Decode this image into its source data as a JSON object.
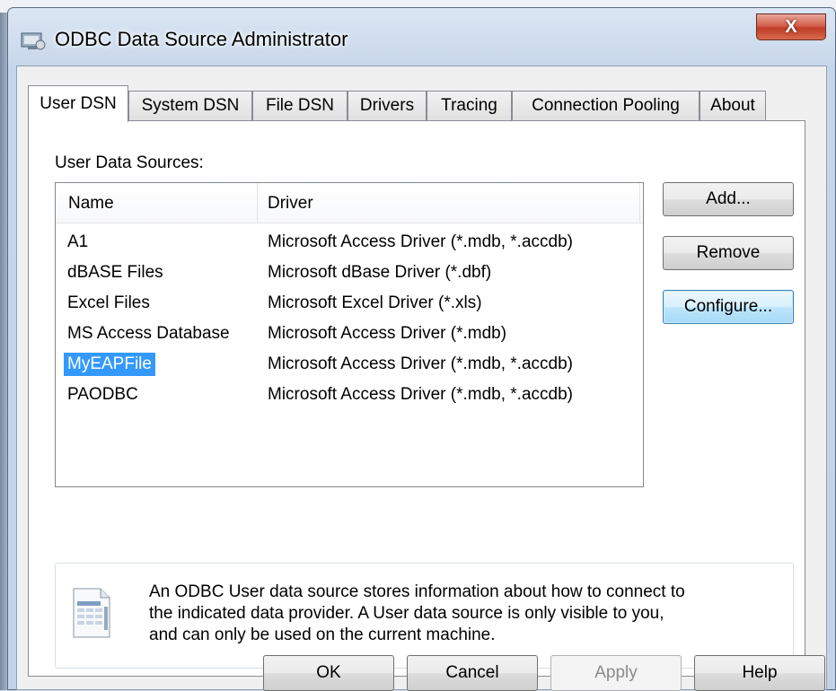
{
  "window": {
    "title": "ODBC Data Source Administrator",
    "close_glyph": "X"
  },
  "tabs": [
    {
      "label": "User DSN",
      "active": true
    },
    {
      "label": "System DSN"
    },
    {
      "label": "File DSN"
    },
    {
      "label": "Drivers"
    },
    {
      "label": "Tracing"
    },
    {
      "label": "Connection Pooling"
    },
    {
      "label": "About"
    }
  ],
  "user_dsn": {
    "section_label": "User Data Sources:",
    "columns": {
      "name": "Name",
      "driver": "Driver"
    },
    "rows": [
      {
        "name": "A1",
        "driver": "Microsoft Access Driver (*.mdb, *.accdb)"
      },
      {
        "name": "dBASE Files",
        "driver": "Microsoft dBase Driver (*.dbf)"
      },
      {
        "name": "Excel Files",
        "driver": "Microsoft Excel Driver (*.xls)"
      },
      {
        "name": "MS Access Database",
        "driver": "Microsoft Access Driver (*.mdb)"
      },
      {
        "name": "MyEAPFile",
        "driver": "Microsoft Access Driver (*.mdb, *.accdb)",
        "selected": true
      },
      {
        "name": "PAODBC",
        "driver": "Microsoft Access Driver (*.mdb, *.accdb)"
      }
    ],
    "buttons": {
      "add": "Add...",
      "remove": "Remove",
      "configure": "Configure..."
    },
    "info_lines": [
      "An ODBC User data source stores information about how to connect to",
      "the indicated data provider.   A User data source is only visible to you,",
      "and can only be used on the current machine."
    ]
  },
  "footer": {
    "ok": "OK",
    "cancel": "Cancel",
    "apply": "Apply",
    "help": "Help"
  },
  "colors": {
    "selection": "#3399ff",
    "focus_button": "#3c7fb1"
  }
}
